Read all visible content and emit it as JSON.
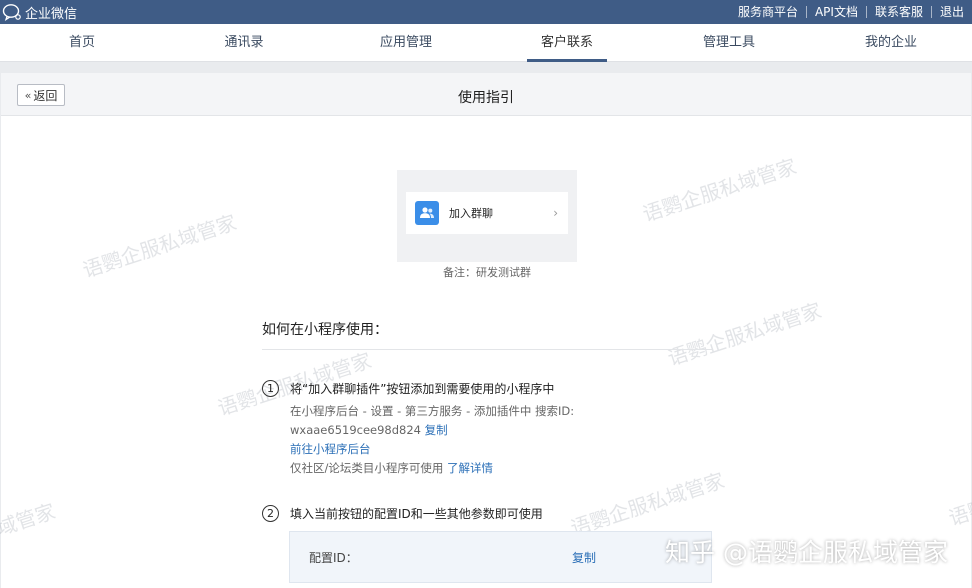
{
  "topbar": {
    "brand": "企业微信",
    "links": [
      "服务商平台",
      "API文档",
      "联系客服",
      "退出"
    ]
  },
  "nav": {
    "items": [
      "首页",
      "通讯录",
      "应用管理",
      "客户联系",
      "管理工具",
      "我的企业"
    ],
    "active": "客户联系"
  },
  "subheader": {
    "back_label": "返回",
    "title": "使用指引"
  },
  "preview": {
    "button_label": "加入群聊",
    "remark": "备注：研发测试群"
  },
  "guide": {
    "heading": "如何在小程序使用：",
    "step1": {
      "num": "1",
      "title": "将“加入群聊插件”按钮添加到需要使用的小程序中",
      "line1": "在小程序后台 - 设置 - 第三方服务 - 添加插件中 搜索ID:",
      "plugin_id": "wxaae6519cee98d824",
      "copy_label": "复制",
      "goto_link": "前往小程序后台",
      "note": "仅社区/论坛类目小程序可使用",
      "details_link": "了解详情"
    },
    "step2": {
      "num": "2",
      "title": "填入当前按钮的配置ID和一些其他参数即可使用",
      "config_label": "配置ID：",
      "copy_label": "复制"
    }
  },
  "watermarks": {
    "text": "语鹦企服私域管家",
    "partial": "域管家",
    "footer": "知乎 @语鹦企服私域管家"
  },
  "colors": {
    "topbar": "#3f5c86",
    "link": "#2b6fb7",
    "plugin_icon": "#3b8ee8"
  }
}
